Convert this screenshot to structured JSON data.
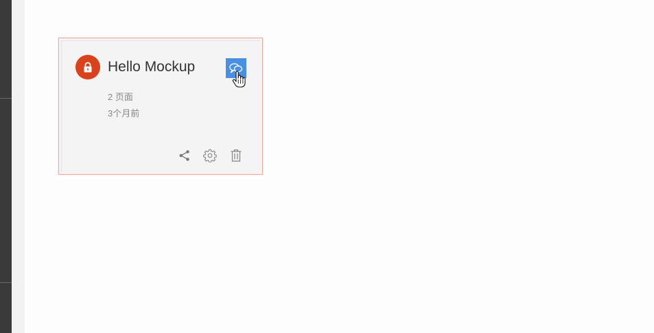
{
  "card": {
    "title": "Hello Mockup",
    "pages": "2 页面",
    "updated": "3个月前",
    "icons": {
      "status": "lock-icon",
      "comment": "comment-icon",
      "share": "share-icon",
      "settings": "gear-icon",
      "delete": "trash-icon"
    }
  },
  "colors": {
    "lock_badge": "#d9421c",
    "comment_button": "#4a90e2",
    "card_border": "#f3a79b",
    "card_background": "#f4f4f4",
    "left_rail": "#3a3a3a"
  }
}
